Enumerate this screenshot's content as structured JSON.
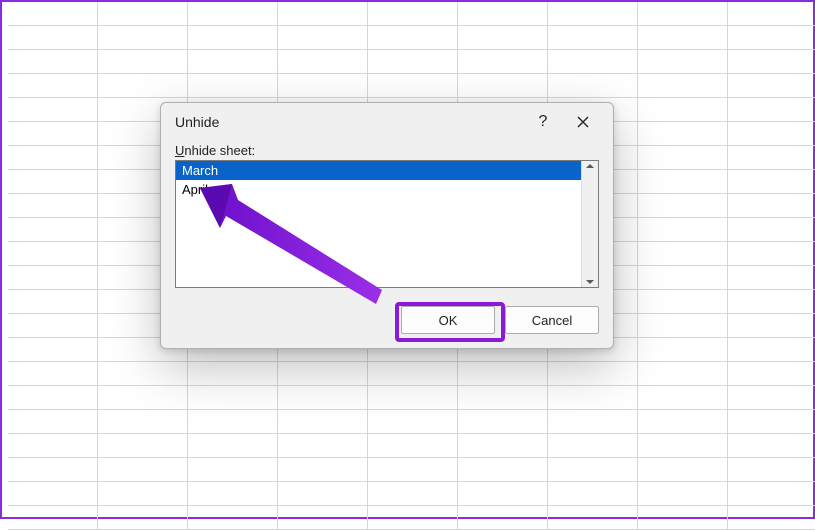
{
  "dialog": {
    "title": "Unhide",
    "help_label": "?",
    "list_label_prefix": "U",
    "list_label_rest": "nhide sheet:",
    "items": [
      "March",
      "April"
    ],
    "selected_index": 0,
    "ok_label": "OK",
    "cancel_label": "Cancel"
  },
  "annotation": {
    "highlight_color": "#8a1ad8"
  }
}
